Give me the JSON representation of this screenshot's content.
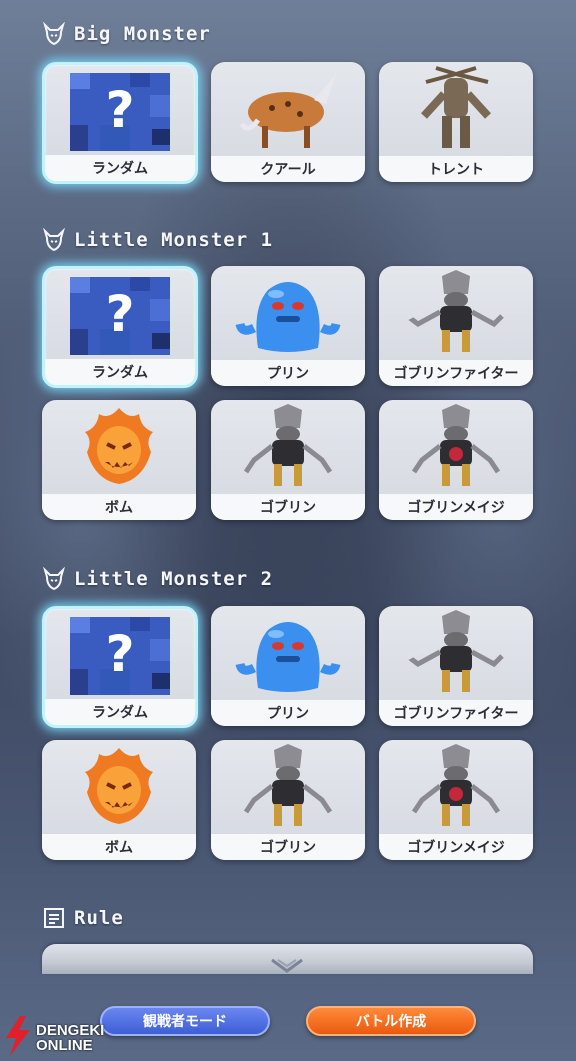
{
  "sections": {
    "big": {
      "title": "Big Monster",
      "cards": [
        {
          "label": "ランダム",
          "selected": true,
          "icon": "random-question-icon"
        },
        {
          "label": "クアール",
          "selected": false,
          "icon": "coeurl-icon"
        },
        {
          "label": "トレント",
          "selected": false,
          "icon": "treant-icon"
        }
      ]
    },
    "little1": {
      "title": "Little Monster 1",
      "cards": [
        {
          "label": "ランダム",
          "selected": true,
          "icon": "random-question-icon"
        },
        {
          "label": "プリン",
          "selected": false,
          "icon": "flan-icon"
        },
        {
          "label": "ゴブリンファイター",
          "selected": false,
          "icon": "goblin-fighter-icon"
        },
        {
          "label": "ボム",
          "selected": false,
          "icon": "bomb-icon"
        },
        {
          "label": "ゴブリン",
          "selected": false,
          "icon": "goblin-icon"
        },
        {
          "label": "ゴブリンメイジ",
          "selected": false,
          "icon": "goblin-mage-icon"
        }
      ]
    },
    "little2": {
      "title": "Little Monster 2",
      "cards": [
        {
          "label": "ランダム",
          "selected": true,
          "icon": "random-question-icon"
        },
        {
          "label": "プリン",
          "selected": false,
          "icon": "flan-icon"
        },
        {
          "label": "ゴブリンファイター",
          "selected": false,
          "icon": "goblin-fighter-icon"
        },
        {
          "label": "ボム",
          "selected": false,
          "icon": "bomb-icon"
        },
        {
          "label": "ゴブリン",
          "selected": false,
          "icon": "goblin-icon"
        },
        {
          "label": "ゴブリンメイジ",
          "selected": false,
          "icon": "goblin-mage-icon"
        }
      ]
    },
    "rule": {
      "title": "Rule"
    }
  },
  "buttons": {
    "spectate_label": "観戦者モード",
    "create_label": "バトル作成"
  },
  "watermark": {
    "line1": "DENGEKI",
    "line2": "ONLINE"
  },
  "colors": {
    "selected_glow": "#78dcff",
    "spectate_button": "#3d5fd6",
    "create_button": "#ea5a10"
  }
}
